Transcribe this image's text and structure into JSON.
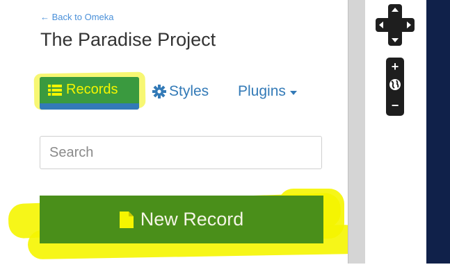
{
  "header": {
    "back_link": "← Back to Omeka",
    "title": "The Paradise Project"
  },
  "nav": {
    "records_label": "Records",
    "styles_label": "Styles",
    "plugins_label": "Plugins"
  },
  "search": {
    "placeholder": "Search",
    "value": ""
  },
  "actions": {
    "new_record_label": "New Record"
  },
  "map": {
    "zoom_in": "+",
    "zoom_out": "−"
  },
  "colors": {
    "link_blue": "#337ab7",
    "highlight_yellow": "#f5f500",
    "primary_green": "#4a8f1a",
    "map_dark": "#10214a"
  },
  "icons": {
    "records": "list-icon",
    "styles": "gear-icon",
    "new_record": "file-icon",
    "map_pan": "pan-arrows-icon",
    "map_globe": "globe-icon"
  }
}
